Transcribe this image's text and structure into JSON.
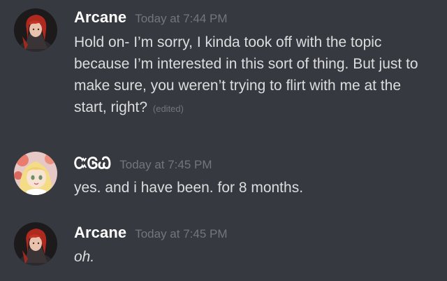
{
  "messages": [
    {
      "username": "Arcane",
      "timestamp": "Today at 7:44 PM",
      "text": "Hold on- I’m sorry, I kinda took off with the topic because I’m interested in this sort of thing. But just to make sure, you weren’t trying to flirt with me at the start, right?",
      "edited_label": "(edited)",
      "avatar": "red-haired-character-avatar"
    },
    {
      "username": "ᏨᎶᏇ",
      "timestamp": "Today at 7:45 PM",
      "text": "yes. and i have been. for 8 months.",
      "avatar": "blonde-anime-character-avatar"
    },
    {
      "username": "Arcane",
      "timestamp": "Today at 7:45 PM",
      "text": "oh.",
      "avatar": "red-haired-character-avatar"
    }
  ],
  "colors": {
    "background": "#36393f",
    "username": "#ffffff",
    "timestamp": "#72767d",
    "message_text": "#dcddde"
  }
}
